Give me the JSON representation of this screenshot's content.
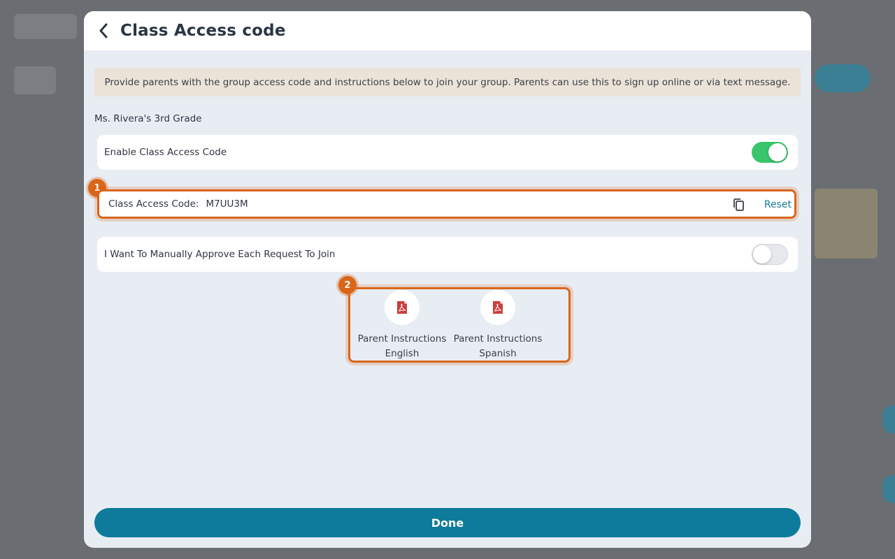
{
  "modal": {
    "title": "Class Access code",
    "info_text": "Provide parents with the group access code and instructions below to join your group. Parents can use this to sign up online or via text message.",
    "class_name": "Ms. Rivera's 3rd Grade",
    "enable_code": {
      "label": "Enable Class Access Code",
      "enabled": true
    },
    "access_code": {
      "label": "Class Access Code:",
      "value": "M7UU3M",
      "reset_label": "Reset"
    },
    "manual_approve": {
      "label": "I Want To Manually Approve Each Request To Join",
      "enabled": false
    },
    "documents": [
      {
        "line1": "Parent Instructions",
        "line2": "English",
        "icon": "pdf-icon"
      },
      {
        "line1": "Parent Instructions",
        "line2": "Spanish",
        "icon": "pdf-icon"
      }
    ],
    "done_label": "Done"
  },
  "annotations": {
    "badge_1": "1",
    "badge_2": "2"
  },
  "colors": {
    "accent": "#0e7a9c",
    "toggle_on": "#39c56b",
    "highlight": "#d9661a",
    "pdf_red": "#c9403f"
  }
}
